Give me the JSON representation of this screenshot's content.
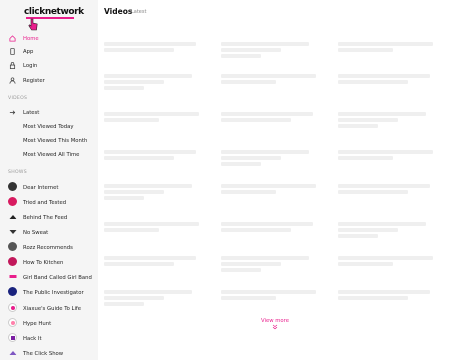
{
  "brand": {
    "logo_text": "clicknetwork",
    "accent": "#e91e8c"
  },
  "nav": [
    {
      "label": "Home",
      "icon": "home-icon",
      "active": true
    },
    {
      "label": "App",
      "icon": "phone-icon"
    },
    {
      "label": "Login",
      "icon": "lock-icon"
    },
    {
      "label": "Register",
      "icon": "user-icon"
    }
  ],
  "videos_section": {
    "title": "VIDEOS",
    "items": [
      "Latest",
      "Most Viewed Today",
      "Most Viewed This Month",
      "Most Viewed All Time"
    ]
  },
  "shows_section": {
    "title": "SHOWS",
    "items": [
      "Dear Internet",
      "Tried and Tested",
      "Behind The Feed",
      "No Sweat",
      "Rozz Recommends",
      "How To Kitchen",
      "Girl Band Called Girl Band",
      "The Public Investigator",
      "Xiaxue's Guide To Life",
      "Hype Hunt",
      "Hack It",
      "The Click Show"
    ]
  },
  "main": {
    "title": "Videos",
    "subtitle": "Latest",
    "view_more": "View more"
  }
}
